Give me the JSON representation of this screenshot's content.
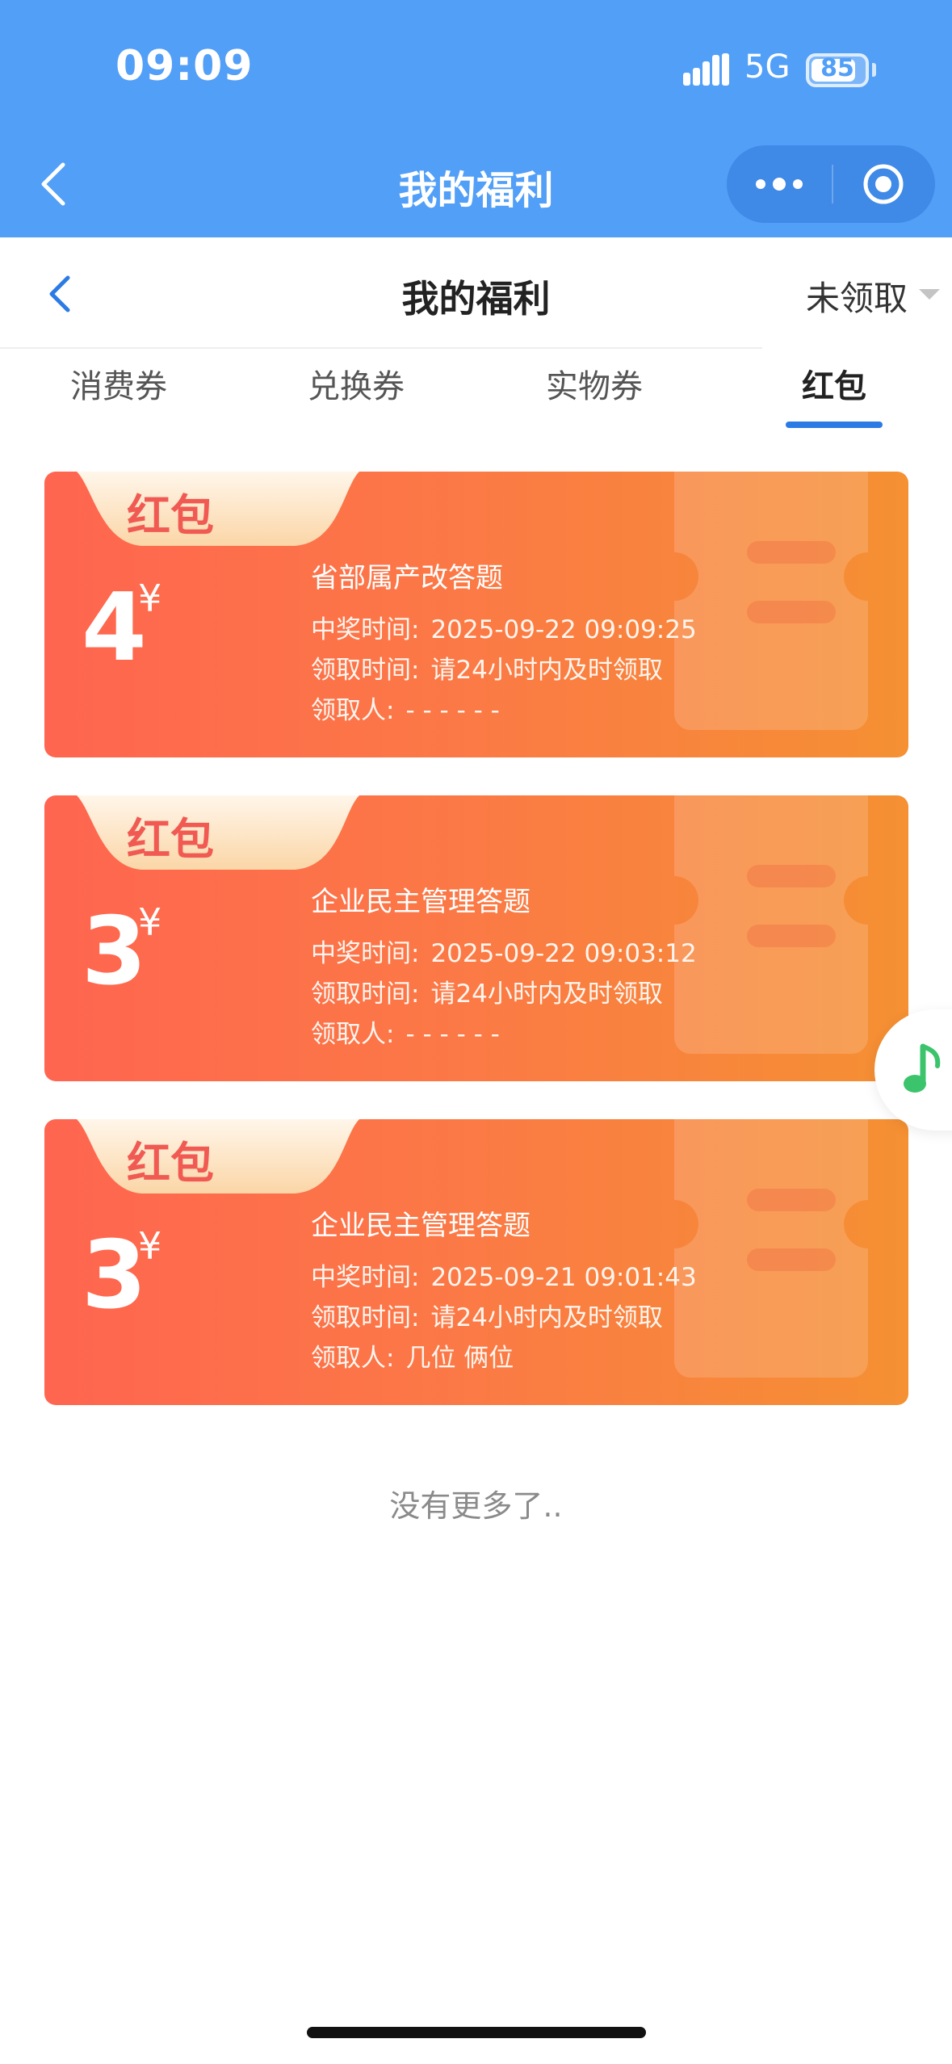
{
  "status_bar": {
    "time": "09:09",
    "network": "5G",
    "battery": "85",
    "battery_level": 0.85
  },
  "nav": {
    "title": "我的福利"
  },
  "sub_header": {
    "title": "我的福利",
    "filter": "未领取"
  },
  "tabs": [
    {
      "label": "消费券",
      "active": false
    },
    {
      "label": "兑换券",
      "active": false
    },
    {
      "label": "实物券",
      "active": false
    },
    {
      "label": "红包",
      "active": true
    }
  ],
  "cards": [
    {
      "tag": "红包",
      "amount": "4",
      "currency": "¥",
      "title": "省部属产改答题",
      "win_time_label": "中奖时间:",
      "win_time": "2025-09-22 09:09:25",
      "claim_time_label": "领取时间:",
      "claim_time": "请24小时内及时领取",
      "claimer_label": "领取人:",
      "claimer": "- - - - - -"
    },
    {
      "tag": "红包",
      "amount": "3",
      "currency": "¥",
      "title": "企业民主管理答题",
      "win_time_label": "中奖时间:",
      "win_time": "2025-09-22 09:03:12",
      "claim_time_label": "领取时间:",
      "claim_time": "请24小时内及时领取",
      "claimer_label": "领取人:",
      "claimer": "- - - - - -"
    },
    {
      "tag": "红包",
      "amount": "3",
      "currency": "¥",
      "title": "企业民主管理答题",
      "win_time_label": "中奖时间:",
      "win_time": "2025-09-21 09:01:43",
      "claim_time_label": "领取时间:",
      "claim_time": "请24小时内及时领取",
      "claimer_label": "领取人:",
      "claimer": "几位 俩位"
    }
  ],
  "footer": {
    "no_more": "没有更多了.."
  },
  "icons": {
    "nav_back": "chevron-left-icon",
    "capsule_more": "more-dots-icon",
    "capsule_close": "target-close-icon",
    "music": "music-note-icon"
  },
  "colors": {
    "nav_bg": "#529ff7",
    "tab_active": "#2c7be5",
    "card_start": "#ff6550",
    "card_end": "#f59033",
    "music": "#3cc46c"
  }
}
